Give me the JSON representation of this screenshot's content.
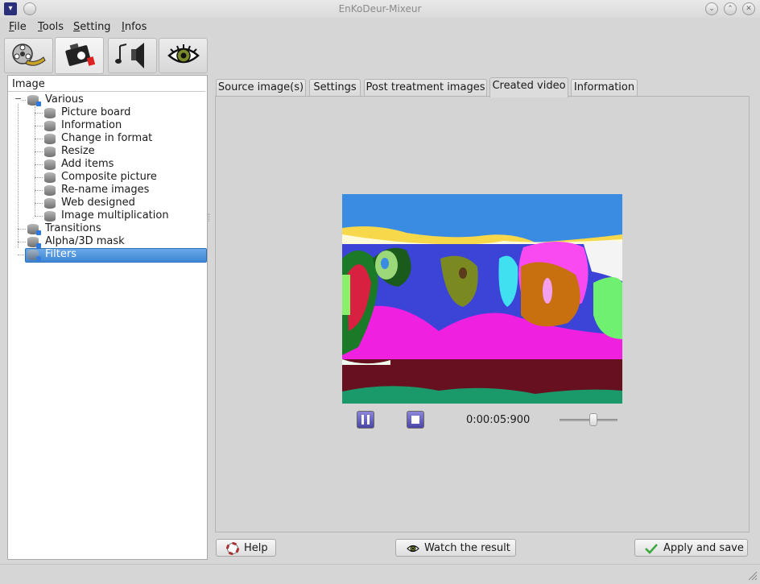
{
  "window": {
    "title": "EnKoDeur-Mixeur"
  },
  "menu": [
    {
      "label": "File",
      "mnemonic": "F",
      "rest": "ile"
    },
    {
      "label": "Tools",
      "mnemonic": "T",
      "rest": "ools"
    },
    {
      "label": "Setting",
      "mnemonic": "S",
      "rest": "etting"
    },
    {
      "label": "Infos",
      "mnemonic": "I",
      "rest": "nfos"
    }
  ],
  "toolbar": {
    "buttons": [
      {
        "icon": "film-reel-icon",
        "active": false
      },
      {
        "icon": "camera-icon",
        "active": true
      },
      {
        "icon": "music-speaker-icon",
        "active": false
      },
      {
        "icon": "eye-icon",
        "active": false
      }
    ]
  },
  "tree": {
    "header": "Image",
    "items": [
      {
        "label": "Various",
        "level": 1,
        "expanded": true
      },
      {
        "label": "Picture board",
        "level": 2
      },
      {
        "label": "Information",
        "level": 2
      },
      {
        "label": "Change in format",
        "level": 2
      },
      {
        "label": "Resize",
        "level": 2
      },
      {
        "label": "Add items",
        "level": 2
      },
      {
        "label": "Composite picture",
        "level": 2
      },
      {
        "label": "Re-name images",
        "level": 2
      },
      {
        "label": "Web designed",
        "level": 2
      },
      {
        "label": "Image multiplication",
        "level": 2
      },
      {
        "label": "Transitions",
        "level": 1
      },
      {
        "label": "Alpha/3D mask",
        "level": 1
      },
      {
        "label": "Filters",
        "level": 1,
        "selected": true
      }
    ]
  },
  "tabs": [
    {
      "label": "Source image(s)"
    },
    {
      "label": "Settings"
    },
    {
      "label": "Post treatment images"
    },
    {
      "label": "Created video",
      "active": true
    },
    {
      "label": "Information"
    }
  ],
  "player": {
    "timecode": "0:00:05:900",
    "pause_icon": "pause-icon",
    "stop_icon": "stop-icon",
    "volume_level": 0.58
  },
  "buttons": {
    "help": "Help",
    "watch": "Watch the result",
    "apply": "Apply and save"
  },
  "colors": {
    "selection": "#3d86d6",
    "media_button": "#5a55bd"
  }
}
